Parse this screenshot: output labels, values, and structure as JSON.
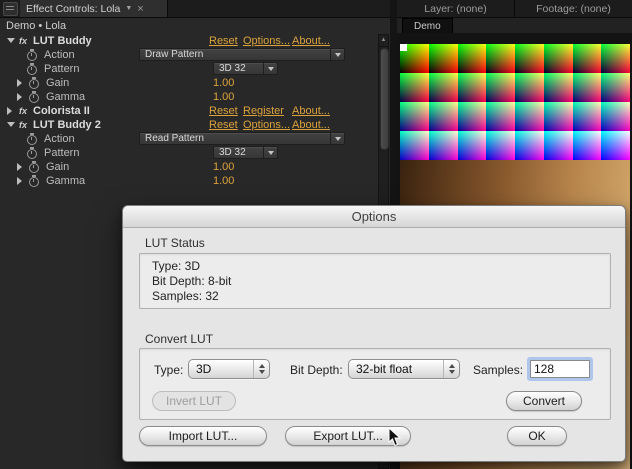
{
  "icons": {
    "menu_caret": "▼",
    "close": "×",
    "scroll_up": "▲"
  },
  "left_panel": {
    "tab_title": "Effect Controls: Lola",
    "breadcrumb": "Demo • Lola",
    "fx_glyph": "fx",
    "effects": [
      {
        "name": "LUT Buddy",
        "links": [
          "Reset",
          "Options...",
          "About..."
        ],
        "props": [
          {
            "label": "Action",
            "value": "Draw Pattern"
          },
          {
            "label": "Pattern",
            "value": "3D 32"
          },
          {
            "label": "Gain",
            "value": "1.00"
          },
          {
            "label": "Gamma",
            "value": "1.00"
          }
        ]
      },
      {
        "name": "Colorista II",
        "links": [
          "Reset",
          "Register",
          "About..."
        ],
        "props": []
      },
      {
        "name": "LUT Buddy 2",
        "links": [
          "Reset",
          "Options...",
          "About..."
        ],
        "props": [
          {
            "label": "Action",
            "value": "Read Pattern"
          },
          {
            "label": "Pattern",
            "value": "3D 32"
          },
          {
            "label": "Gain",
            "value": "1.00"
          },
          {
            "label": "Gamma",
            "value": "1.00"
          }
        ]
      }
    ]
  },
  "right_panel": {
    "tabs": [
      "Layer: (none)",
      "Footage: (none)"
    ],
    "viewer_tab": "Demo",
    "pattern": {
      "columns": 8,
      "count": 32
    }
  },
  "dialog": {
    "title": "Options",
    "lut_status": {
      "label": "LUT Status",
      "lines": [
        "Type: 3D",
        "Bit Depth: 8-bit",
        "Samples: 32"
      ]
    },
    "convert_lut": {
      "label": "Convert LUT",
      "type_label": "Type:",
      "type_value": "3D",
      "bit_depth_label": "Bit Depth:",
      "bit_depth_value": "32-bit float",
      "samples_label": "Samples:",
      "samples_value": "128",
      "invert_label": "Invert LUT",
      "convert_label": "Convert"
    },
    "import_label": "Import LUT...",
    "export_label": "Export LUT...",
    "ok_label": "OK"
  },
  "colors": {
    "accent_orange": "#dca33d",
    "panel_bg": "#282828",
    "dialog_bg": "#e5e5e5"
  }
}
